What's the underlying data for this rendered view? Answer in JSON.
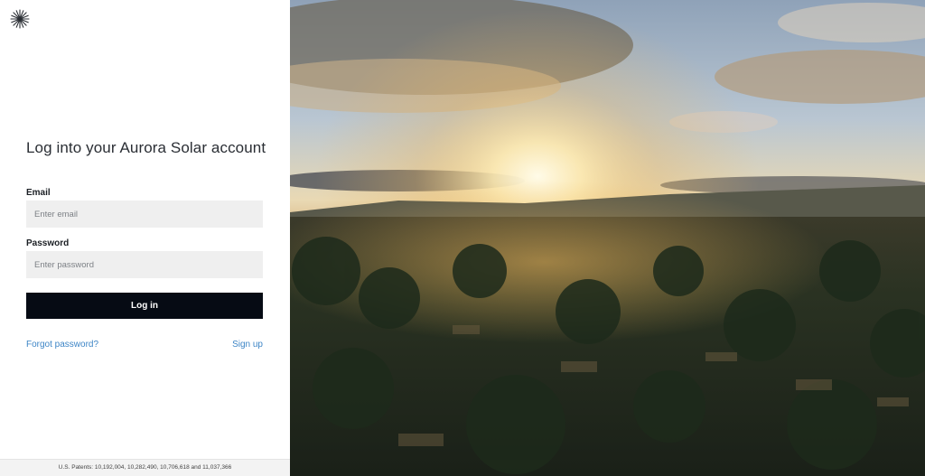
{
  "brand": {
    "logo_icon": "sunburst-logo-icon"
  },
  "login": {
    "title": "Log into your Aurora Solar account",
    "email_label": "Email",
    "email_placeholder": "Enter email",
    "email_value": "",
    "password_label": "Password",
    "password_placeholder": "Enter password",
    "password_value": "",
    "login_button": "Log in",
    "forgot_link": "Forgot password?",
    "signup_link": "Sign up"
  },
  "footer": {
    "patents": "U.S. Patents: 10,192,004, 10,282,490, 10,706,618 and 11,037,366"
  },
  "colors": {
    "accent_link": "#3d85c6",
    "button_bg": "#060b14",
    "input_bg": "#efefef"
  }
}
